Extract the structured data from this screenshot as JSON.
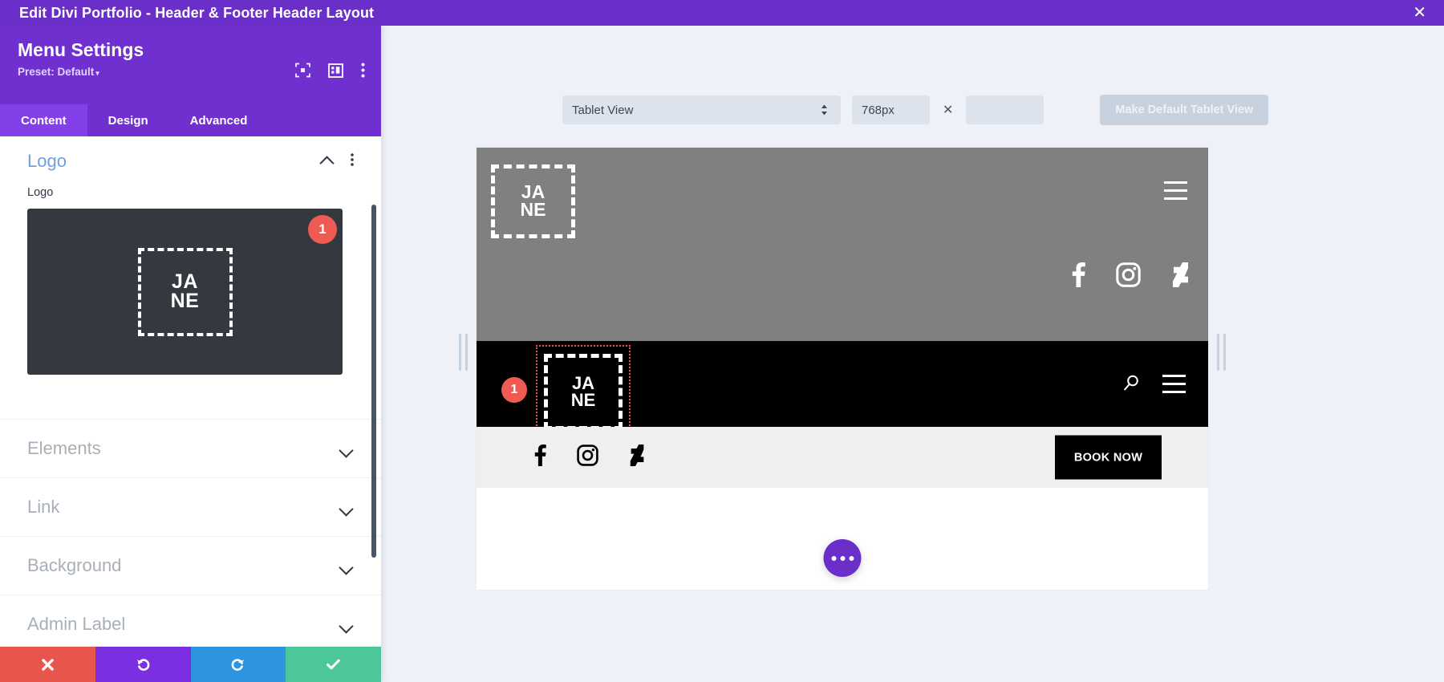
{
  "titlebar": {
    "title": "Edit Divi Portfolio - Header & Footer Header Layout",
    "close_label": "✕"
  },
  "panel": {
    "title": "Menu Settings",
    "preset": "Preset: Default",
    "preset_caret": "▾",
    "icons": [
      "focus-icon",
      "layout-panel-icon",
      "kebab-menu-icon"
    ],
    "tabs": [
      {
        "label": "Content",
        "active": true
      },
      {
        "label": "Design",
        "active": false
      },
      {
        "label": "Advanced",
        "active": false
      }
    ],
    "open_section": {
      "title": "Logo",
      "field_label": "Logo",
      "logo_line1": "JA",
      "logo_line2": "NE",
      "badge": "1"
    },
    "sections": [
      {
        "label": "Elements"
      },
      {
        "label": "Link"
      },
      {
        "label": "Background"
      },
      {
        "label": "Admin Label"
      }
    ],
    "footer_buttons": [
      {
        "name": "discard-button",
        "icon": "close-x-icon",
        "color": "#e8554d"
      },
      {
        "name": "undo-button",
        "icon": "undo-arrow-icon",
        "color": "#7b2fe0"
      },
      {
        "name": "redo-button",
        "icon": "redo-arrow-icon",
        "color": "#2f94e0"
      },
      {
        "name": "save-button",
        "icon": "checkmark-icon",
        "color": "#4dc79a"
      }
    ]
  },
  "viewport_toolbar": {
    "view_mode": "Tablet View",
    "width_value": "768px",
    "width_placeholder": "",
    "times_symbol": "✕",
    "height_value": "",
    "height_placeholder": "",
    "make_default_label": "Make Default Tablet View"
  },
  "preview": {
    "hero": {
      "logo_line1": "JA",
      "logo_line2": "NE",
      "menu_icon": "hamburger-menu-icon",
      "social": [
        "facebook-icon",
        "instagram-icon",
        "deviantart-icon"
      ]
    },
    "black_bar": {
      "badge": "1",
      "logo_line1": "JA",
      "logo_line2": "NE",
      "icons": [
        "search-icon",
        "hamburger-menu-icon"
      ]
    },
    "light_bar": {
      "social": [
        "facebook-icon",
        "instagram-icon",
        "deviantart-icon"
      ],
      "cta_label": "BOOK NOW"
    },
    "fab": "more-options-icon"
  },
  "colors": {
    "brand_purple": "#6b2fc9",
    "panel_purple": "#7030d0",
    "tab_active": "#8440e8",
    "badge_red": "#ef5a52",
    "stage_bg": "#eef2f8",
    "hero_gray": "#808080",
    "bar_black": "#000000"
  }
}
